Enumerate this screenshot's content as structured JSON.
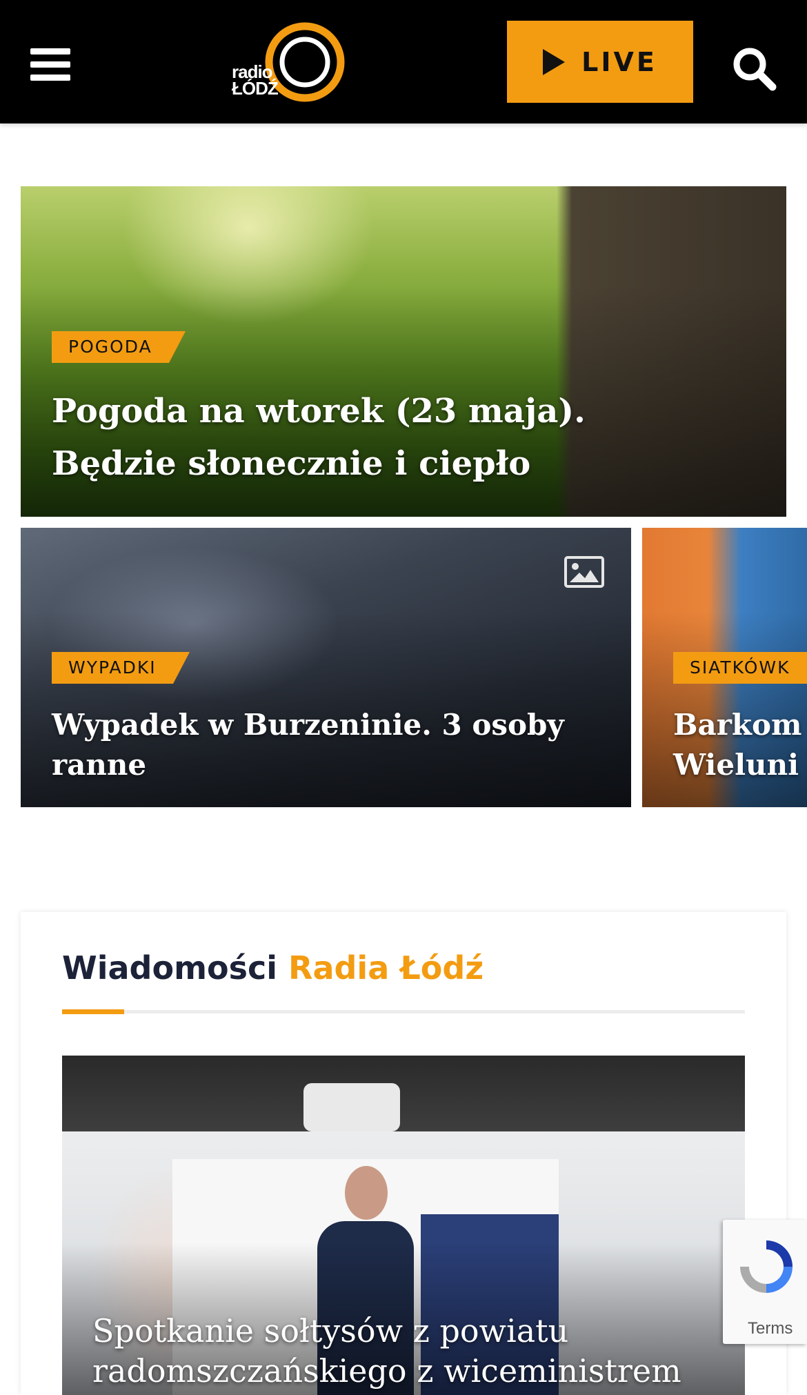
{
  "header": {
    "logo_line1": "radio",
    "logo_line2": "ŁÓDŹ",
    "live_label": "LIVE"
  },
  "hero": {
    "tag": "POGODA",
    "title": "Pogoda na wtorek (23 maja). Będzie słonecznie i ciepło"
  },
  "cards": [
    {
      "tag": "WYPADKI",
      "title": "Wypadek w Burzeninie. 3 osoby ranne"
    },
    {
      "tag": "SIATKÓWK",
      "title_line1": "Barkom",
      "title_line2": "Wieluni"
    }
  ],
  "news": {
    "heading_part1": "Wiadomości",
    "heading_part2": "Radia Łódź",
    "feature_title": "Spotkanie sołtysów z powiatu radomszczańskiego z wiceministrem"
  },
  "recaptcha": {
    "terms": "Terms"
  },
  "colors": {
    "accent": "#f39c12",
    "header_bg": "#000000",
    "heading_dark": "#1c2238"
  },
  "icons": [
    "hamburger-menu-icon",
    "play-icon",
    "search-icon",
    "gallery-image-icon",
    "recaptcha-icon"
  ]
}
